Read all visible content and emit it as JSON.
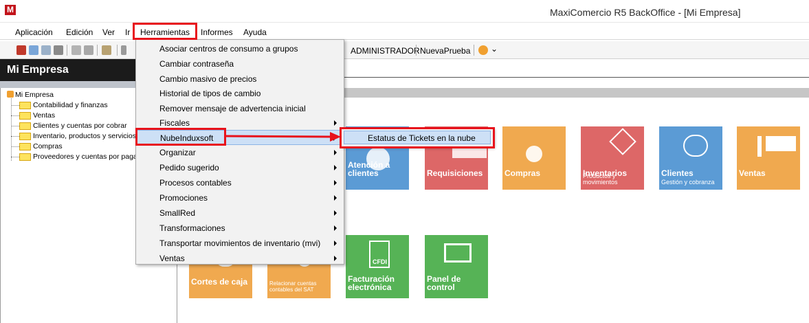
{
  "window": {
    "logo_letter": "M",
    "title": "MaxiComercio R5 BackOffice - [Mi Empresa]"
  },
  "menubar": {
    "items": [
      {
        "label": "Aplicación"
      },
      {
        "label": "Edición"
      },
      {
        "label": "Ver"
      },
      {
        "label": "Ir"
      },
      {
        "label": "Herramientas"
      },
      {
        "label": "Informes"
      },
      {
        "label": "Ayuda"
      }
    ]
  },
  "toolbar": {
    "user": "ADMINISTRADOR",
    "database": "NuevaPrueba"
  },
  "left_panel": {
    "title": "Mi Empresa",
    "tree": {
      "root": "Mi Empresa",
      "children": [
        "Contabilidad y finanzas",
        "Ventas",
        "Clientes y cuentas por cobrar",
        "Inventario, productos y servicios",
        "Compras",
        "Proveedores y cuentas por pagar"
      ]
    }
  },
  "tiles": [
    {
      "title": "Atención a\nclientes",
      "subtitle": "",
      "color": "#5b9bd5"
    },
    {
      "title": "Requisiciones",
      "subtitle": "",
      "color": "#dd6767"
    },
    {
      "title": "Compras",
      "subtitle": "",
      "color": "#f0a94f"
    },
    {
      "title": "Inventarios",
      "subtitle": "Productos y movimientos",
      "color": "#dd6767"
    },
    {
      "title": "Clientes",
      "subtitle": "Gestión y cobranza",
      "color": "#5b9bd5"
    },
    {
      "title": "Ventas",
      "subtitle": "",
      "color": "#f0a94f"
    },
    {
      "title": "Cortes de caja",
      "subtitle": "",
      "color": "#f0a94f"
    },
    {
      "title": "",
      "subtitle": "Relacionar cuentas contables del SAT",
      "color": "#f0a94f"
    },
    {
      "title": "Facturación\nelectrónica",
      "subtitle": "",
      "color": "#56b356",
      "icon_text": "CFDI"
    },
    {
      "title": "Panel de\ncontrol",
      "subtitle": "",
      "color": "#56b356"
    }
  ],
  "herramientas_menu": {
    "items": [
      {
        "label": "Asociar centros de consumo a grupos",
        "submenu": false
      },
      {
        "label": "Cambiar contraseña",
        "submenu": false
      },
      {
        "label": "Cambio masivo de precios",
        "submenu": false
      },
      {
        "label": "Historial de tipos de cambio",
        "submenu": false
      },
      {
        "label": "Remover mensaje de advertencia inicial",
        "submenu": false
      },
      {
        "label": "Fiscales",
        "submenu": true
      },
      {
        "label": "NubeInduxsoft",
        "submenu": true,
        "highlighted": true
      },
      {
        "label": "Organizar",
        "submenu": true
      },
      {
        "label": "Pedido sugerido",
        "submenu": true
      },
      {
        "label": "Procesos contables",
        "submenu": true
      },
      {
        "label": "Promociones",
        "submenu": true
      },
      {
        "label": "SmallRed",
        "submenu": true
      },
      {
        "label": "Transformaciones",
        "submenu": true
      },
      {
        "label": "Transportar movimientos de inventario (mvi)",
        "submenu": true
      },
      {
        "label": "Ventas",
        "submenu": true
      }
    ]
  },
  "nube_submenu": {
    "items": [
      {
        "label": "Estatus de Tickets en la nube"
      }
    ]
  },
  "annotation_color": "#e8121b"
}
